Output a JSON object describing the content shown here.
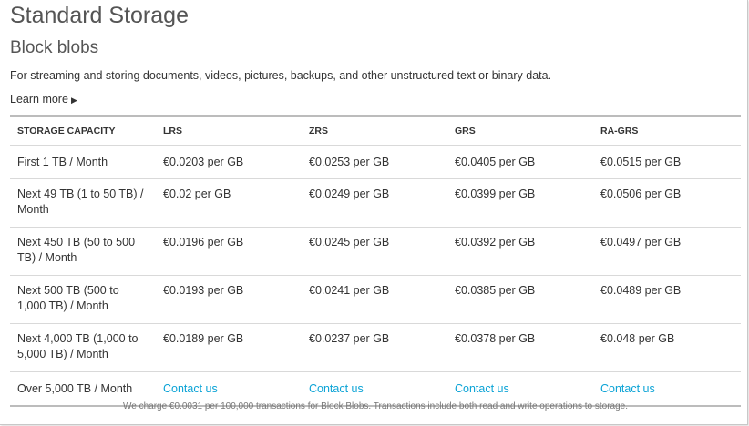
{
  "page": {
    "title": "Standard Storage",
    "subtitle": "Block blobs",
    "description": "For streaming and storing documents, videos, pictures, backups, and other unstructured text or binary data.",
    "learn_more": "Learn more",
    "learn_more_icon": "triangle-right-icon"
  },
  "table": {
    "headers": [
      "STORAGE CAPACITY",
      "LRS",
      "ZRS",
      "GRS",
      "RA-GRS"
    ],
    "rows": [
      {
        "capacity": "First 1 TB / Month",
        "lrs": "€0.0203 per GB",
        "zrs": "€0.0253 per GB",
        "grs": "€0.0405 per GB",
        "ragrs": "€0.0515 per GB"
      },
      {
        "capacity": "Next 49 TB (1 to 50 TB) / Month",
        "lrs": "€0.02 per GB",
        "zrs": "€0.0249 per GB",
        "grs": "€0.0399 per GB",
        "ragrs": "€0.0506 per GB"
      },
      {
        "capacity": "Next 450 TB (50 to 500 TB) / Month",
        "lrs": "€0.0196 per GB",
        "zrs": "€0.0245 per GB",
        "grs": "€0.0392 per GB",
        "ragrs": "€0.0497 per GB"
      },
      {
        "capacity": "Next 500 TB (500 to 1,000 TB) / Month",
        "lrs": "€0.0193 per GB",
        "zrs": "€0.0241 per GB",
        "grs": "€0.0385 per GB",
        "ragrs": "€0.0489 per GB"
      },
      {
        "capacity": "Next 4,000 TB (1,000 to 5,000 TB) / Month",
        "lrs": "€0.0189 per GB",
        "zrs": "€0.0237 per GB",
        "grs": "€0.0378 per GB",
        "ragrs": "€0.048 per GB"
      },
      {
        "capacity": "Over 5,000 TB / Month",
        "lrs": "Contact us",
        "zrs": "Contact us",
        "grs": "Contact us",
        "ragrs": "Contact us"
      }
    ]
  },
  "footnote": "We charge €0.0031 per 100,000 transactions for Block Blobs. Transactions include both read and write operations to storage.",
  "colors": {
    "link": "#0ba3d6",
    "heading": "#555555",
    "text": "#333333",
    "rule": "#d9d9d9"
  }
}
